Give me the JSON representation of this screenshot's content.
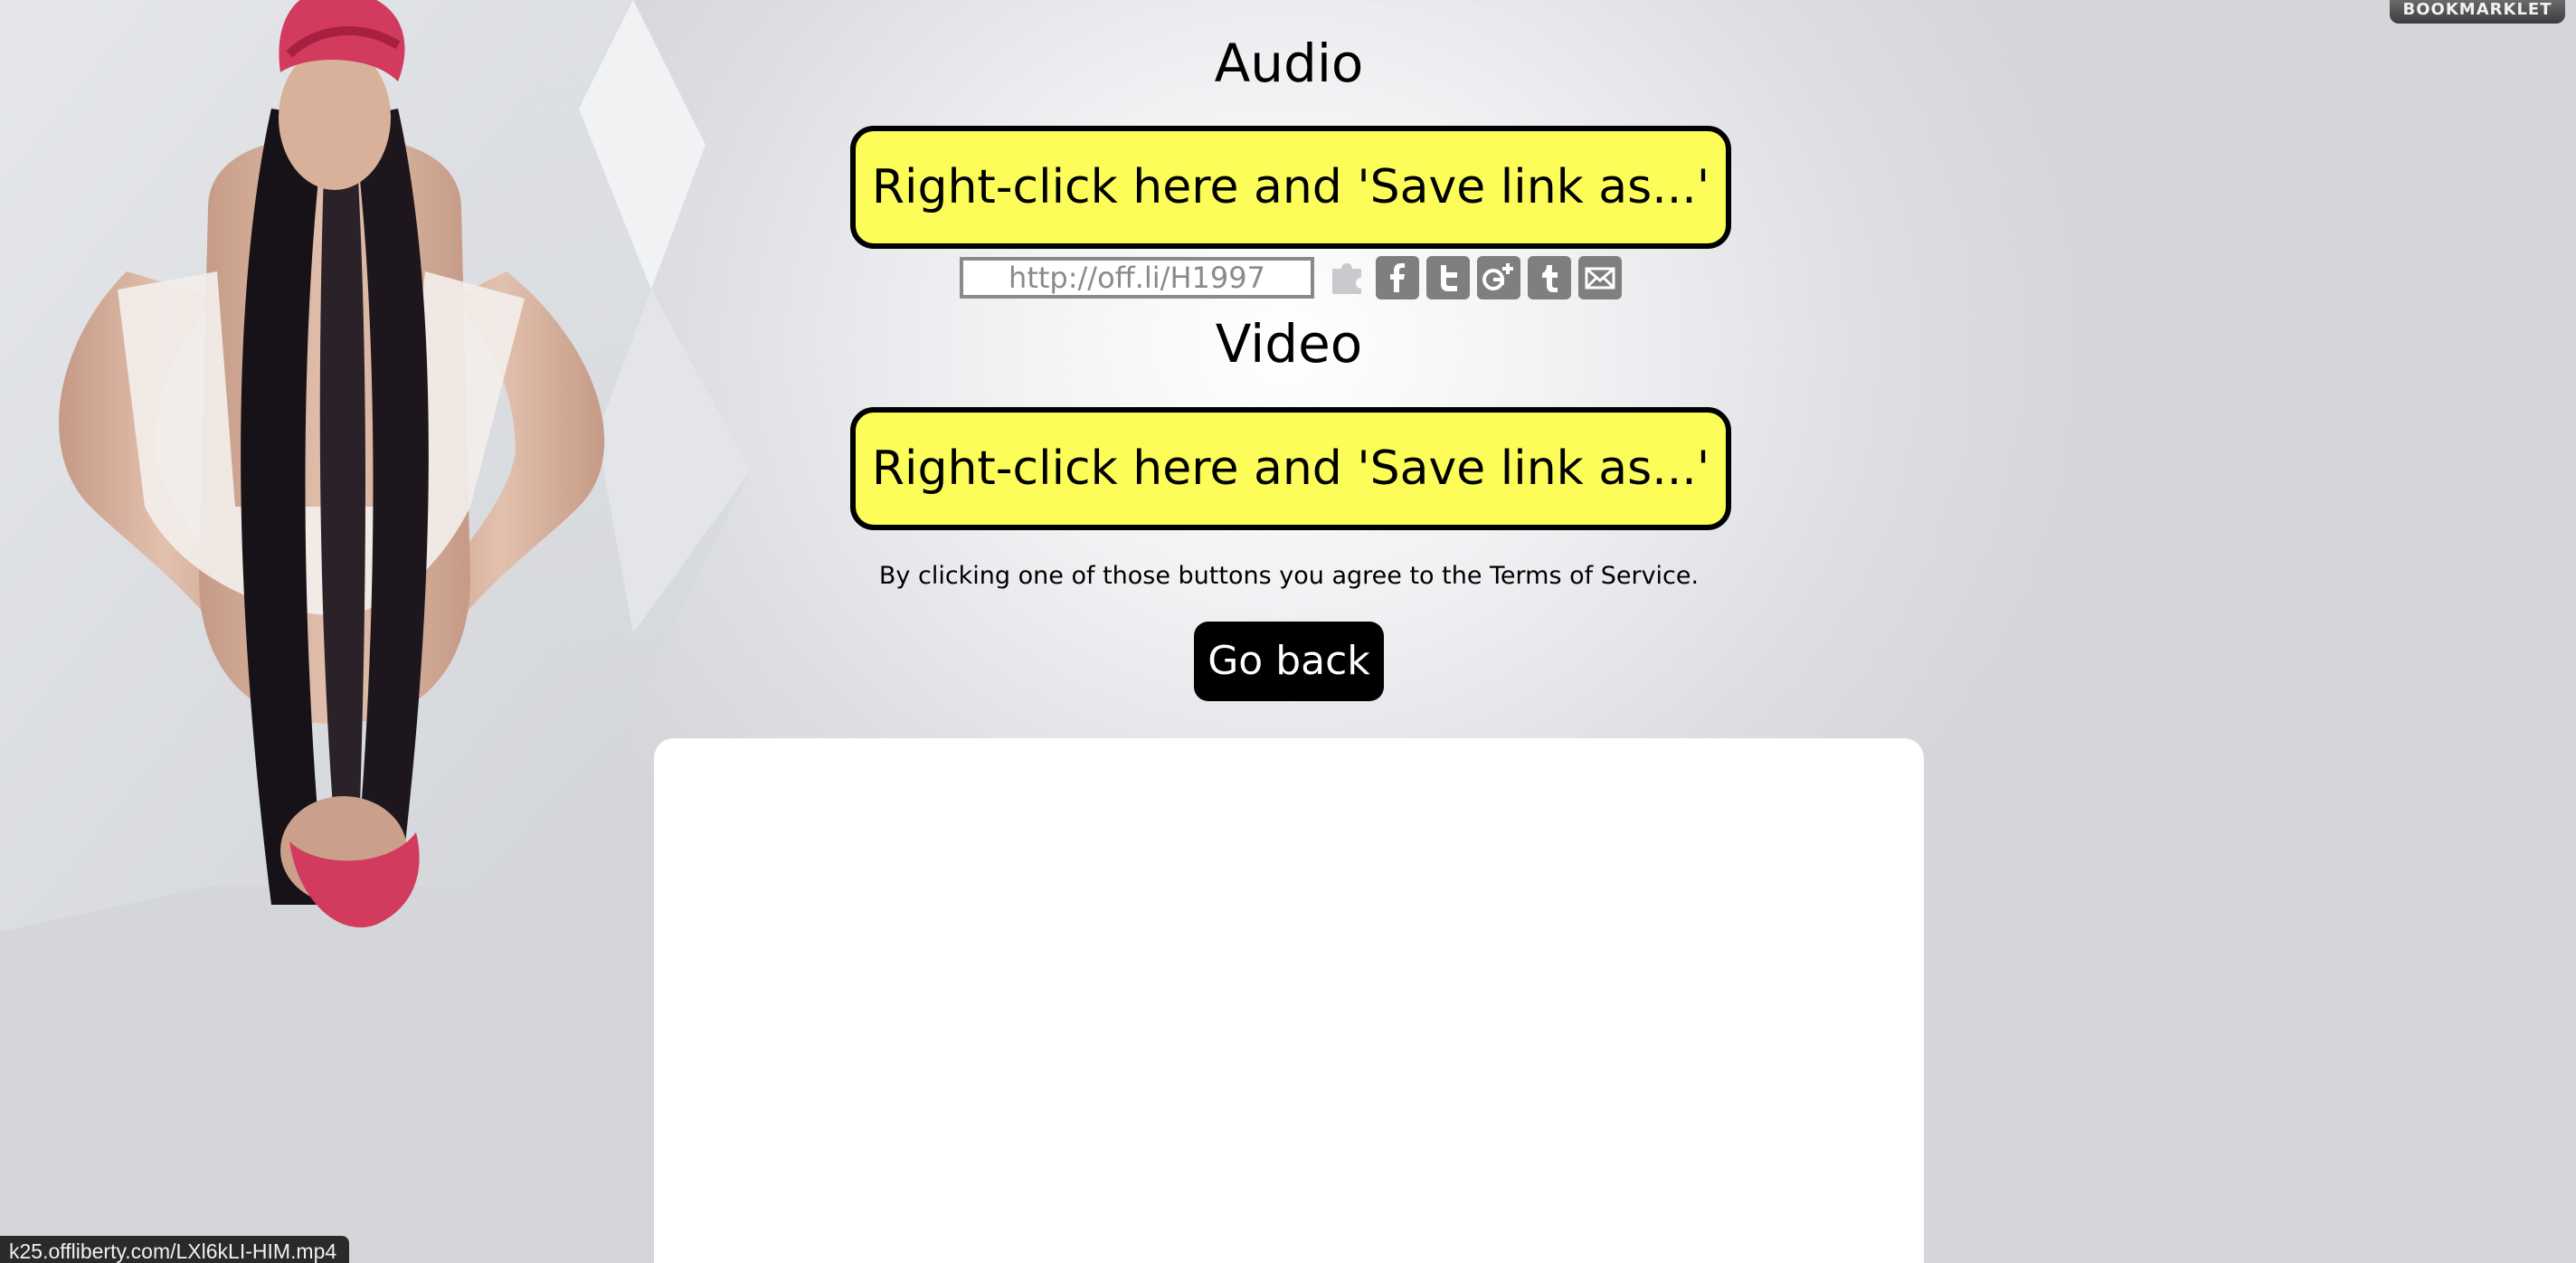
{
  "bookmarklet": {
    "label": "BOOKMARKLET"
  },
  "audio": {
    "title": "Audio",
    "save_label": "Right-click here and 'Save link as...'"
  },
  "share": {
    "short_url": "http://off.li/H1997",
    "icons": [
      "puzzle-icon",
      "facebook-icon",
      "twitter-icon",
      "google-plus-icon",
      "tumblr-icon",
      "email-icon"
    ]
  },
  "video": {
    "title": "Video",
    "save_label": "Right-click here and 'Save link as...'"
  },
  "tos_text": "By clicking one of those buttons you agree to the Terms of Service.",
  "go_back_label": "Go back",
  "status_bar": {
    "url": "k25.offliberty.com/LXl6kLI-HIM.mp4"
  },
  "colors": {
    "save_button": "#fcfd58",
    "go_back": "#000000",
    "share_icons": "#7f7f7f"
  }
}
